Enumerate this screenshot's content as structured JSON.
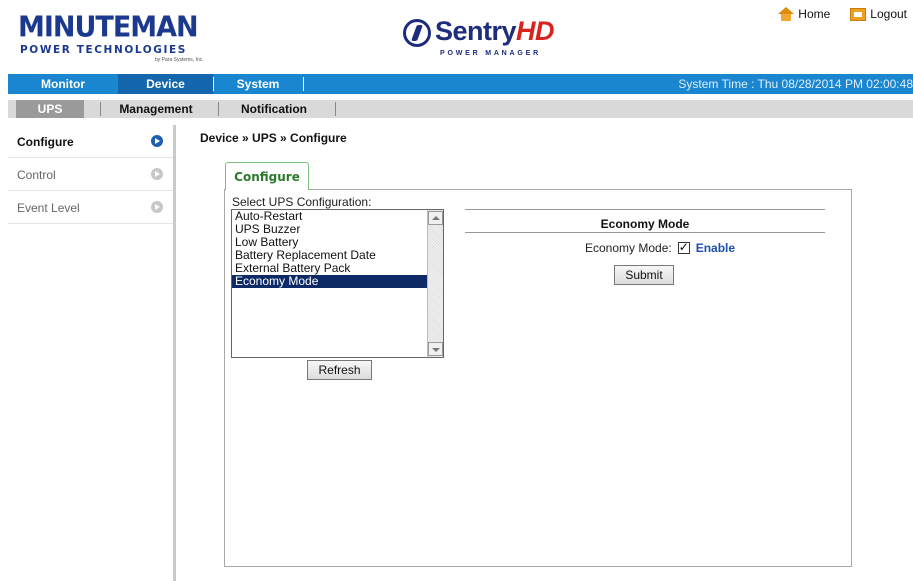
{
  "header": {
    "brand_left": {
      "word": "MINUTEMAN",
      "sub": "POWER TECHNOLOGIES",
      "tagline": "by Para Systems, Inc."
    },
    "brand_center": {
      "word": "Sentry",
      "word_accent": "HD",
      "sub": "POWER MANAGER"
    },
    "links": {
      "home": "Home",
      "logout": "Logout"
    }
  },
  "main_nav": {
    "items": [
      "Monitor",
      "Device",
      "System"
    ],
    "active": "Device",
    "system_time": "System Time : Thu 08/28/2014 PM 02:00:48"
  },
  "sub_nav": {
    "items": [
      "UPS",
      "Management",
      "Notification"
    ],
    "active": "UPS"
  },
  "left_menu": {
    "items": [
      "Configure",
      "Control",
      "Event Level"
    ],
    "active": "Configure"
  },
  "content": {
    "breadcrumb": "Device » UPS » Configure",
    "tab": "Configure",
    "select_label": "Select UPS Configuration:",
    "options": [
      "Auto-Restart",
      "UPS Buzzer",
      "Low Battery",
      "Battery Replacement Date",
      "External Battery Pack",
      "Economy Mode"
    ],
    "selected_option": "Economy Mode",
    "refresh_label": "Refresh",
    "section_title": "Economy Mode",
    "field_label": "Economy Mode:",
    "checkbox_checked": true,
    "checkbox_label": "Enable",
    "submit_label": "Submit"
  },
  "colors": {
    "nav_blue": "#1a86d0",
    "nav_active": "#1567ad",
    "selected_row": "#0d2a66",
    "tab_green": "#2b7a2b",
    "enable_blue": "#1f4fa8"
  }
}
